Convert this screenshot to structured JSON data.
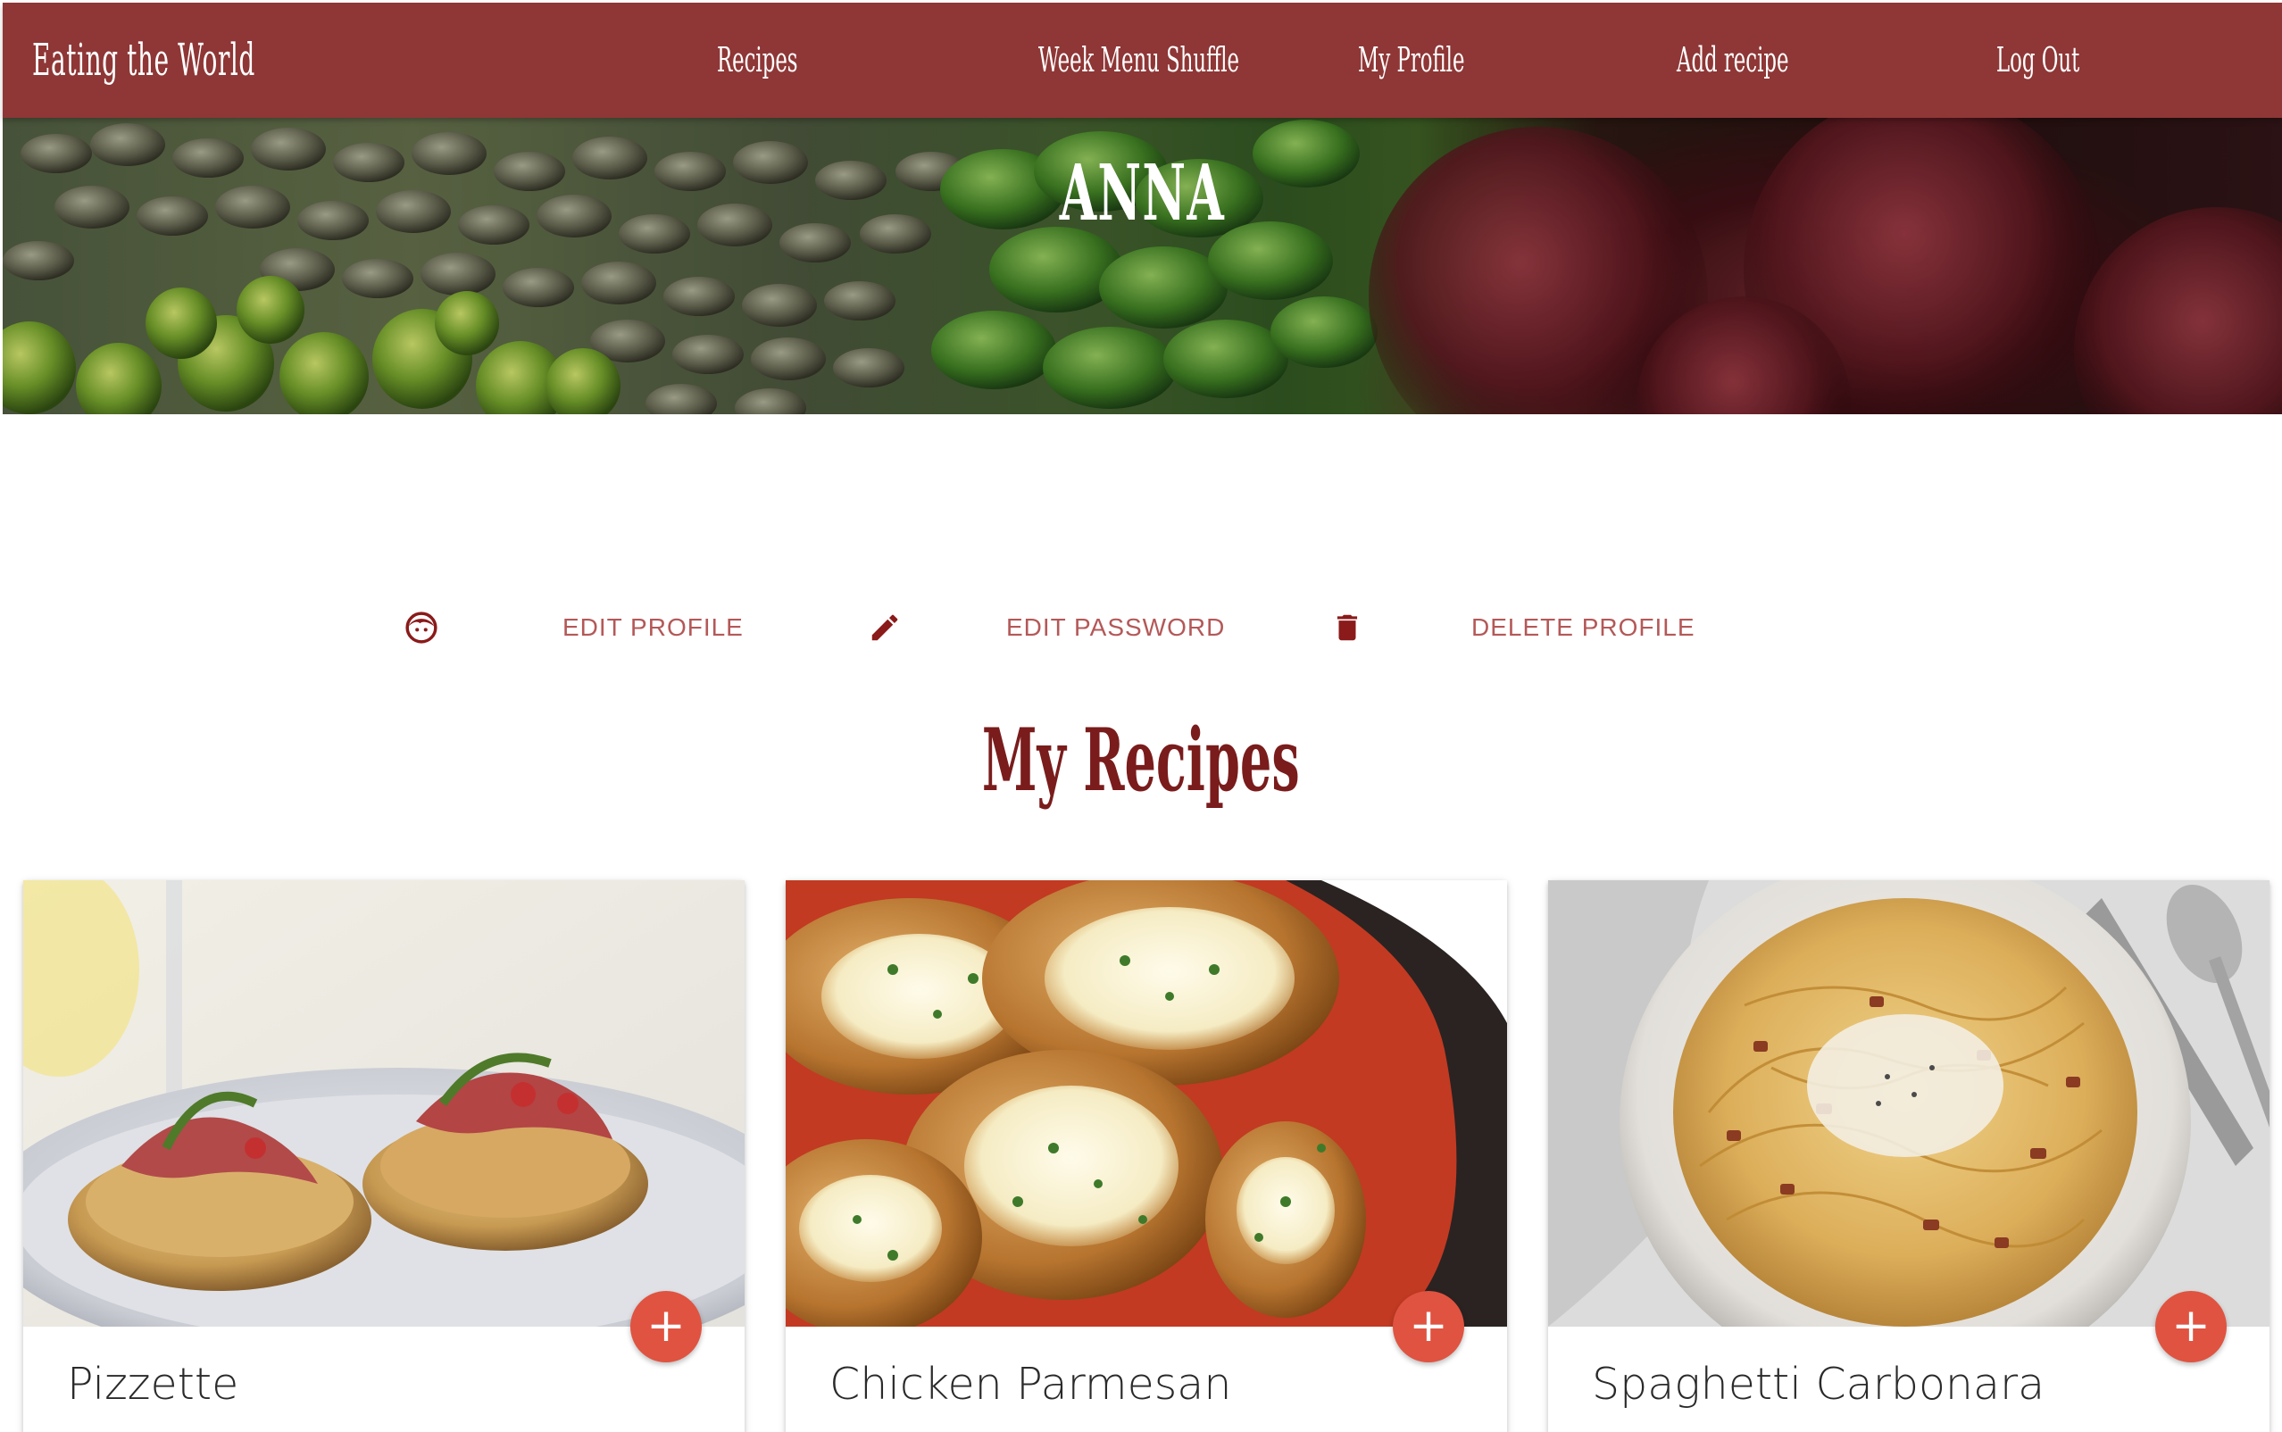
{
  "navbar": {
    "brand": "Eating the World",
    "links": [
      "Recipes",
      "Week Menu Shuffle",
      "My Profile",
      "Add recipe",
      "Log Out"
    ]
  },
  "hero": {
    "title": "ANNA"
  },
  "actions": {
    "edit_profile": "EDIT PROFILE",
    "edit_password": "EDIT PASSWORD",
    "delete_profile": "DELETE PROFILE"
  },
  "section": {
    "title": "My Recipes"
  },
  "recipes": [
    {
      "title": "Pizzette",
      "add_icon": "+"
    },
    {
      "title": "Chicken Parmesan",
      "add_icon": "+"
    },
    {
      "title": "Spaghetti Carbonara",
      "add_icon": "+"
    }
  ],
  "icons": {
    "face": "face-icon",
    "pencil": "pencil-icon",
    "trash": "trash-icon",
    "plus": "plus-icon"
  },
  "colors": {
    "navbar_bg": "#8e3736",
    "accent_text": "#b45858",
    "title_text": "#7a1c1c",
    "icon": "#8b1a1a",
    "fab": "#e05340"
  }
}
